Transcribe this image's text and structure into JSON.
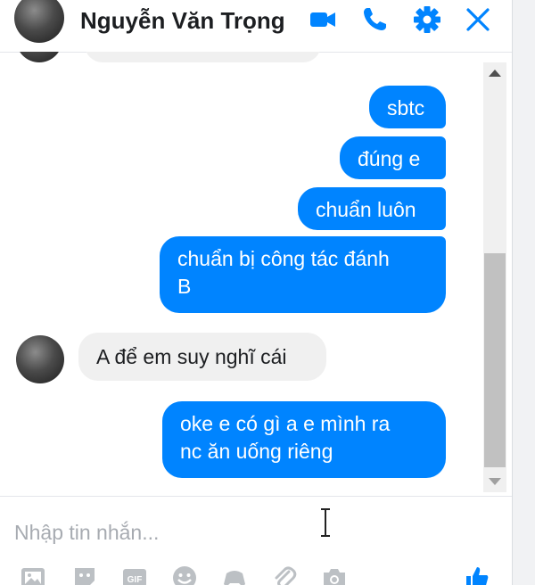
{
  "header": {
    "contact_name": "Nguyễn Văn Trọng"
  },
  "messages": [
    {
      "direction": "out",
      "text": "sbtc"
    },
    {
      "direction": "out",
      "text": "đúng e"
    },
    {
      "direction": "out",
      "text": "chuẩn luôn"
    },
    {
      "direction": "out",
      "text": "chuẩn bị công tác đánh\nB"
    },
    {
      "direction": "in",
      "text": "A để em suy nghĩ cái"
    },
    {
      "direction": "out",
      "text": "oke e có gì a e mình ra\nnc ăn uống riêng"
    }
  ],
  "composer": {
    "placeholder": "Nhập tin nhắn..."
  },
  "toolbar": {
    "gif_label": "GIF"
  },
  "colors": {
    "accent": "#0084ff",
    "incoming_bubble": "#f0f0f0"
  },
  "icons": {
    "header": [
      "video-call-icon",
      "phone-icon",
      "gear-icon",
      "close-icon"
    ],
    "toolbar": [
      "photo-icon",
      "sticker-icon",
      "gif-icon",
      "emoji-icon",
      "game-icon",
      "attach-icon",
      "camera-icon",
      "like-icon"
    ]
  }
}
